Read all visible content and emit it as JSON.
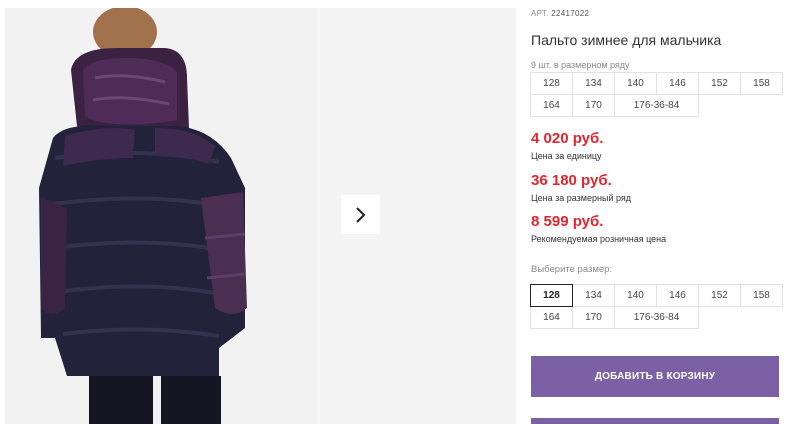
{
  "gallery": {
    "image_description_icon": "boy-in-winter-coat-photo",
    "next_icon": "chevron-right-icon"
  },
  "product": {
    "article_prefix": "АРТ.",
    "article_number": "22417022",
    "title": "Пальто зимнее для мальчика",
    "pack_note": "9 шт. в размерном ряду"
  },
  "pack_sizes": [
    "128",
    "134",
    "140",
    "146",
    "152",
    "158",
    "164",
    "170",
    "176-36-84"
  ],
  "prices": {
    "unit_price": "4 020 руб.",
    "unit_label": "Цена за единицу",
    "pack_price": "36 180 руб.",
    "pack_label": "Цена за размерный ряд",
    "retail_price": "8 599 руб.",
    "retail_label": "Рекомендуемая розничная цена"
  },
  "size_picker": {
    "label": "Выберите размер:",
    "selected": "128",
    "options": [
      "128",
      "134",
      "140",
      "146",
      "152",
      "158",
      "164",
      "170",
      "176-36-84"
    ]
  },
  "actions": {
    "add_to_cart": "ДОБАВИТЬ В КОРЗИНУ"
  },
  "colors": {
    "accent_purple": "#7b61a3",
    "price_red": "#e0262f"
  }
}
